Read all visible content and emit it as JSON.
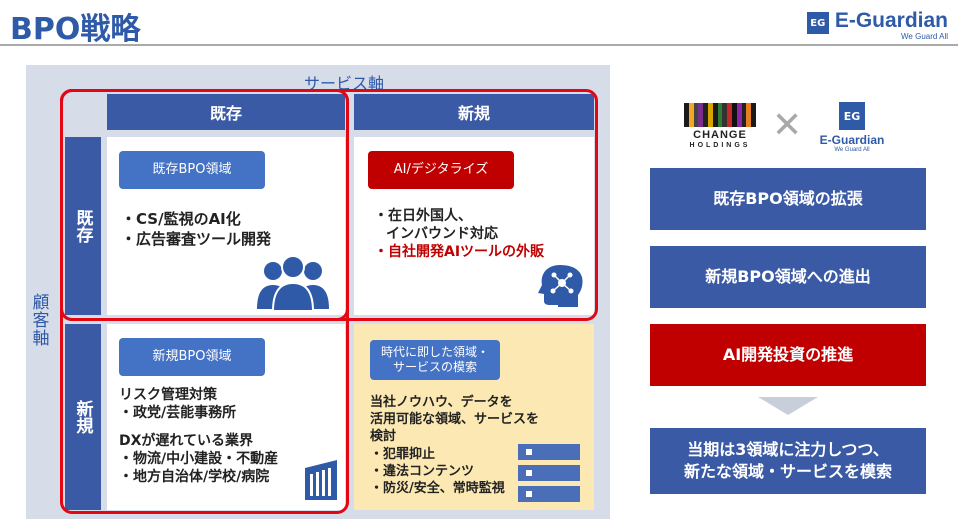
{
  "header": {
    "title": "BPO戦略",
    "logo_box": "EG",
    "logo_text": "E-Guardian",
    "logo_sub": "We Guard All"
  },
  "matrix": {
    "service_axis": "サービス軸",
    "customer_axis": "顧客軸",
    "col_existing": "既存",
    "col_new": "新規",
    "row_existing": "既存",
    "row_new": "新規",
    "cell_ee": {
      "tag": "既存BPO領域",
      "lines": [
        "・CS/監視のAI化",
        "・広告審査ツール開発"
      ]
    },
    "cell_en": {
      "tag": "AI/デジタライズ",
      "line1": "・在日外国人、",
      "line2": "インバウンド対応",
      "line3": "・自社開発AIツールの外販"
    },
    "cell_ne": {
      "tag": "新規BPO領域",
      "lines": [
        "リスク管理対策",
        "・政党/芸能事務所",
        "",
        "DXが遅れている業界",
        "・物流/中小建設・不動産",
        "・地方自治体/学校/病院"
      ]
    },
    "cell_nn": {
      "tag_line1": "時代に即した領域・",
      "tag_line2": "サービスの模索",
      "lines": [
        "当社ノウハウ、データを",
        "活用可能な領域、サービスを",
        "検討"
      ],
      "red_lines": [
        "・犯罪抑止",
        "・違法コンテンツ",
        "・防災/安全、常時監視"
      ]
    }
  },
  "right": {
    "change_logo": "CHANGE",
    "change_sub": "HOLDINGS",
    "times": "✕",
    "eg_box": "EG",
    "eg_text": "E-Guardian",
    "eg_sub": "We Guard All",
    "box1": "既存BPO領域の拡張",
    "box2": "新規BPO領域への進出",
    "box3": "AI開発投資の推進",
    "box4_line1": "当期は3領域に注力しつつ、",
    "box4_line2": "新たな領域・サービスを模索"
  },
  "colors": {
    "brand_blue": "#3b5aa5",
    "accent_red": "#c00000",
    "frame_red": "#e30613",
    "panel": "#d7dce9",
    "highlight": "#fbe8b2"
  }
}
